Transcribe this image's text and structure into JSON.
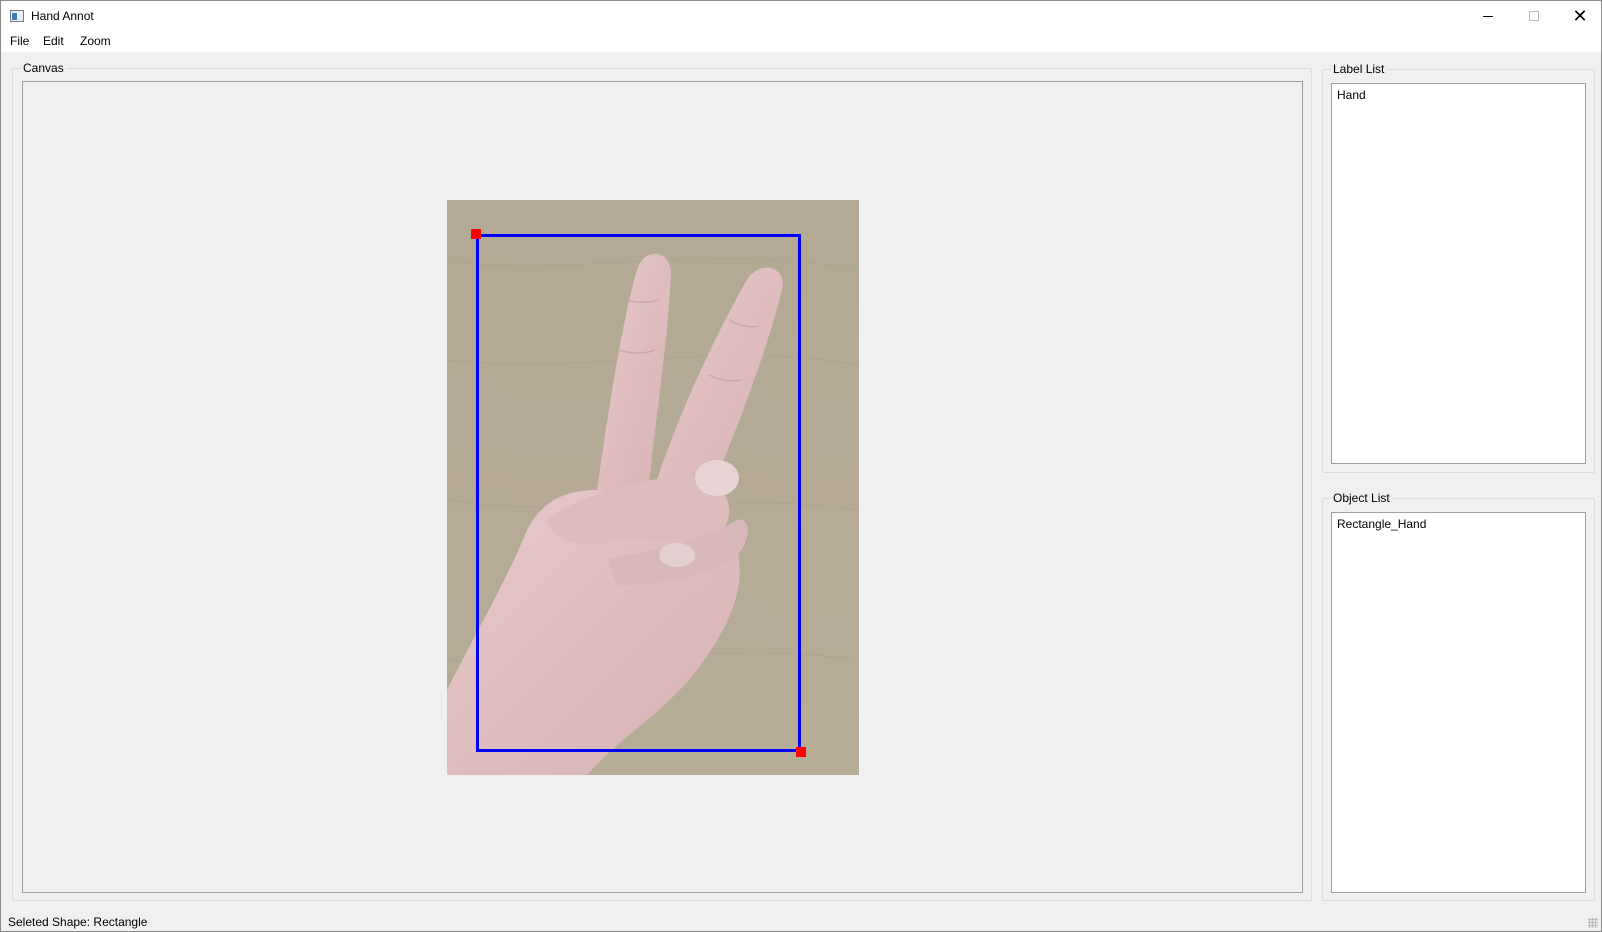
{
  "window": {
    "title": "Hand Annot",
    "icon": "app-window-icon",
    "controls": {
      "minimize": "minimize-icon",
      "maximize": "maximize-icon",
      "close": "close-icon",
      "close_glyph": "✕"
    }
  },
  "menu": {
    "items": [
      {
        "label": "File"
      },
      {
        "label": "Edit"
      },
      {
        "label": "Zoom"
      }
    ]
  },
  "canvas": {
    "title": "Canvas",
    "selection": {
      "shape": "rectangle",
      "color": "#0000ff",
      "handle_color": "#ff0000"
    }
  },
  "label_list": {
    "title": "Label List",
    "items": [
      "Hand"
    ]
  },
  "object_list": {
    "title": "Object List",
    "items": [
      "Rectangle_Hand"
    ]
  },
  "status": {
    "text": "Seleted Shape: Rectangle"
  }
}
